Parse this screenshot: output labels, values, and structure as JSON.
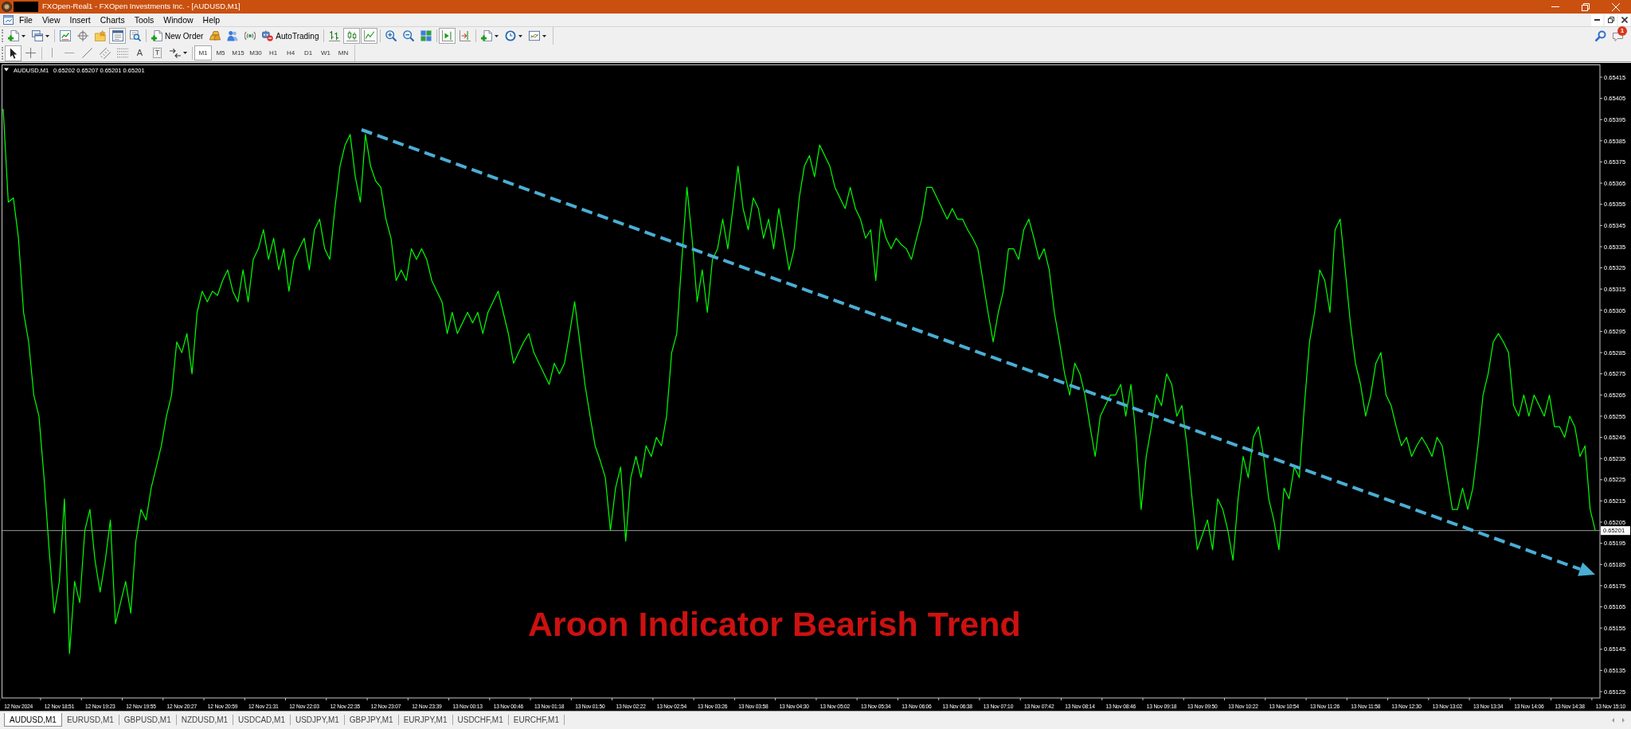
{
  "window": {
    "title": "FXOpen-Real1 - FXOpen Investments Inc. - [AUDUSD,M1]"
  },
  "menu": [
    "File",
    "View",
    "Insert",
    "Charts",
    "Tools",
    "Window",
    "Help"
  ],
  "standard_toolbar": {
    "groups": [
      [
        {
          "kind": "newchart",
          "pressed": false
        },
        {
          "kind": "profiles",
          "pressed": false
        }
      ],
      [
        {
          "kind": "marketwatch",
          "pressed": false
        },
        {
          "kind": "navigator",
          "pressed": false
        },
        {
          "kind": "favorites",
          "pressed": false
        },
        {
          "kind": "datawindow",
          "pressed": true
        },
        {
          "kind": "tester",
          "pressed": false
        }
      ],
      [
        {
          "kind": "neworder",
          "label": "New Order",
          "pressed": false
        },
        {
          "kind": "ingots",
          "pressed": false
        },
        {
          "kind": "editor",
          "pressed": false
        },
        {
          "kind": "signals",
          "pressed": false
        },
        {
          "kind": "autotrading",
          "label": "AutoTrading",
          "pressed": false
        }
      ],
      [
        {
          "kind": "barchart",
          "pressed": false
        },
        {
          "kind": "candles",
          "pressed": true
        },
        {
          "kind": "linechart",
          "pressed": true
        }
      ],
      [
        {
          "kind": "zoomin",
          "pressed": false
        },
        {
          "kind": "zoomout",
          "pressed": false
        },
        {
          "kind": "tile",
          "pressed": false
        }
      ],
      [
        {
          "kind": "autoscroll",
          "pressed": true
        },
        {
          "kind": "chartshift",
          "pressed": false
        }
      ],
      [
        {
          "kind": "indicators",
          "pressed": false
        },
        {
          "kind": "periods",
          "pressed": false
        },
        {
          "kind": "templates",
          "pressed": false
        }
      ]
    ]
  },
  "notifications": {
    "count": "1"
  },
  "line_studies_toolbar": {
    "groups": [
      [
        {
          "kind": "cursor",
          "pressed": true
        },
        {
          "kind": "crosshair",
          "pressed": false
        }
      ],
      [
        {
          "kind": "vline",
          "pressed": false
        },
        {
          "kind": "hline",
          "pressed": false
        },
        {
          "kind": "trendline",
          "pressed": false
        },
        {
          "kind": "channel",
          "pressed": false
        },
        {
          "kind": "fibo",
          "pressed": false
        },
        {
          "kind": "text",
          "glyph": "A",
          "pressed": false
        },
        {
          "kind": "label",
          "glyph": "T",
          "pressed": false
        },
        {
          "kind": "arrows",
          "pressed": false
        }
      ]
    ]
  },
  "timeframes": [
    {
      "label": "M1",
      "selected": true
    },
    {
      "label": "M5",
      "selected": false
    },
    {
      "label": "M15",
      "selected": false
    },
    {
      "label": "M30",
      "selected": false
    },
    {
      "label": "H1",
      "selected": false
    },
    {
      "label": "H4",
      "selected": false
    },
    {
      "label": "D1",
      "selected": false
    },
    {
      "label": "W1",
      "selected": false
    },
    {
      "label": "MN",
      "selected": false
    }
  ],
  "chart": {
    "symbol": "AUDUSD,M1",
    "quote": "0.65202 0.65207 0.65201 0.65201",
    "chart_data": {
      "type": "line",
      "ylim": [
        0.65122,
        0.65421
      ],
      "yticks": [
        0.65415,
        0.65405,
        0.65395,
        0.65385,
        0.65375,
        0.65365,
        0.65355,
        0.65345,
        0.65335,
        0.65325,
        0.65315,
        0.65305,
        0.65295,
        0.65285,
        0.65275,
        0.65265,
        0.65255,
        0.65245,
        0.65235,
        0.65225,
        0.65215,
        0.65205,
        0.65195,
        0.65185,
        0.65175,
        0.65165,
        0.65155,
        0.65145,
        0.65135,
        0.65125
      ],
      "categories": [
        null,
        null,
        null,
        "12 Nov 2024",
        null,
        null,
        null,
        null,
        null,
        null,
        null,
        "12 Nov 18:51",
        null,
        null,
        null,
        null,
        null,
        null,
        null,
        "12 Nov 19:23",
        null,
        null,
        null,
        null,
        null,
        null,
        null,
        "12 Nov 19:55",
        null,
        null,
        null,
        null,
        null,
        null,
        null,
        "12 Nov 20:27",
        null,
        null,
        null,
        null,
        null,
        null,
        null,
        "12 Nov 20:59",
        null,
        null,
        null,
        null,
        null,
        null,
        null,
        "12 Nov 21:31",
        null,
        null,
        null,
        null,
        null,
        null,
        null,
        "12 Nov 22:03",
        null,
        null,
        null,
        null,
        null,
        null,
        null,
        "12 Nov 22:35",
        null,
        null,
        null,
        null,
        null,
        null,
        null,
        "12 Nov 23:07",
        null,
        null,
        null,
        null,
        null,
        null,
        null,
        "12 Nov 23:39",
        null,
        null,
        null,
        null,
        null,
        null,
        null,
        "13 Nov 00:13",
        null,
        null,
        null,
        null,
        null,
        null,
        null,
        "13 Nov 00:46",
        null,
        null,
        null,
        null,
        null,
        null,
        null,
        "13 Nov 01:18",
        null,
        null,
        null,
        null,
        null,
        null,
        null,
        "13 Nov 01:50",
        null,
        null,
        null,
        null,
        null,
        null,
        null,
        "13 Nov 02:22",
        null,
        null,
        null,
        null,
        null,
        null,
        null,
        "13 Nov 02:54",
        null,
        null,
        null,
        null,
        null,
        null,
        null,
        "13 Nov 03:26",
        null,
        null,
        null,
        null,
        null,
        null,
        null,
        "13 Nov 03:58",
        null,
        null,
        null,
        null,
        null,
        null,
        null,
        "13 Nov 04:30",
        null,
        null,
        null,
        null,
        null,
        null,
        null,
        "13 Nov 05:02",
        null,
        null,
        null,
        null,
        null,
        null,
        null,
        "13 Nov 05:34",
        null,
        null,
        null,
        null,
        null,
        null,
        null,
        "13 Nov 06:06",
        null,
        null,
        null,
        null,
        null,
        null,
        null,
        "13 Nov 06:38",
        null,
        null,
        null,
        null,
        null,
        null,
        null,
        "13 Nov 07:10",
        null,
        null,
        null,
        null,
        null,
        null,
        null,
        "13 Nov 07:42",
        null,
        null,
        null,
        null,
        null,
        null,
        null,
        "13 Nov 08:14",
        null,
        null,
        null,
        null,
        null,
        null,
        null,
        "13 Nov 08:46",
        null,
        null,
        null,
        null,
        null,
        null,
        null,
        "13 Nov 09:18",
        null,
        null,
        null,
        null,
        null,
        null,
        null,
        "13 Nov 09:50",
        null,
        null,
        null,
        null,
        null,
        null,
        null,
        "13 Nov 10:22",
        null,
        null,
        null,
        null,
        null,
        null,
        null,
        "13 Nov 10:54",
        null,
        null,
        null,
        null,
        null,
        null,
        null,
        "13 Nov 11:26",
        null,
        null,
        null,
        null,
        null,
        null,
        null,
        "13 Nov 11:58",
        null,
        null,
        null,
        null,
        null,
        null,
        null,
        "13 Nov 12:30",
        null,
        null,
        null,
        null,
        null,
        null,
        null,
        "13 Nov 13:02",
        null,
        null,
        null,
        null,
        null,
        null,
        null,
        "13 Nov 13:34",
        null,
        null,
        null,
        null,
        null,
        null,
        null,
        "13 Nov 14:06",
        null,
        null,
        null,
        null,
        null,
        null,
        null,
        "13 Nov 14:38",
        null,
        null,
        null,
        null,
        null,
        null,
        null,
        "13 Nov 15:10"
      ],
      "series": [
        {
          "color": "#00ff00",
          "values": [
            0.654,
            0.65356,
            0.65358,
            0.65339,
            0.65304,
            0.6529,
            0.65265,
            0.65255,
            0.65226,
            0.65192,
            0.65162,
            0.65177,
            0.65216,
            0.65143,
            0.65177,
            0.65167,
            0.65201,
            0.65211,
            0.65187,
            0.65172,
            0.65187,
            0.65206,
            0.65157,
            0.65167,
            0.65177,
            0.65162,
            0.65196,
            0.65211,
            0.65206,
            0.65221,
            0.65231,
            0.65241,
            0.65255,
            0.65265,
            0.6529,
            0.65285,
            0.65294,
            0.65275,
            0.65304,
            0.65314,
            0.65309,
            0.65314,
            0.65312,
            0.65319,
            0.65324,
            0.65314,
            0.65309,
            0.65324,
            0.65309,
            0.65329,
            0.65334,
            0.65343,
            0.65329,
            0.65339,
            0.65324,
            0.65334,
            0.65314,
            0.65329,
            0.65334,
            0.65339,
            0.65324,
            0.65343,
            0.65348,
            0.65334,
            0.65329,
            0.65353,
            0.65373,
            0.65383,
            0.65388,
            0.65368,
            0.65356,
            0.65388,
            0.65373,
            0.65366,
            0.65363,
            0.65348,
            0.65339,
            0.65319,
            0.65324,
            0.65319,
            0.65334,
            0.65329,
            0.65334,
            0.65329,
            0.65319,
            0.65314,
            0.65309,
            0.65294,
            0.65304,
            0.65294,
            0.65299,
            0.65304,
            0.65299,
            0.65304,
            0.65294,
            0.65304,
            0.65309,
            0.65314,
            0.65304,
            0.65294,
            0.6528,
            0.65285,
            0.6529,
            0.65294,
            0.65285,
            0.6528,
            0.65275,
            0.6527,
            0.6528,
            0.65275,
            0.6528,
            0.65294,
            0.65309,
            0.6529,
            0.6527,
            0.65255,
            0.65241,
            0.65234,
            0.65226,
            0.65201,
            0.65221,
            0.65231,
            0.65196,
            0.65226,
            0.65236,
            0.65226,
            0.65241,
            0.65236,
            0.65245,
            0.65241,
            0.65255,
            0.65285,
            0.65294,
            0.65329,
            0.65363,
            0.65339,
            0.65309,
            0.65324,
            0.65304,
            0.65329,
            0.65334,
            0.65348,
            0.65334,
            0.65353,
            0.65373,
            0.65353,
            0.65343,
            0.65358,
            0.65353,
            0.65339,
            0.65348,
            0.65334,
            0.65353,
            0.65339,
            0.65324,
            0.65334,
            0.65358,
            0.65373,
            0.65378,
            0.65368,
            0.65383,
            0.65378,
            0.65373,
            0.65363,
            0.65358,
            0.65353,
            0.65363,
            0.65353,
            0.65348,
            0.65339,
            0.65343,
            0.65319,
            0.65348,
            0.65339,
            0.65334,
            0.65339,
            0.65336,
            0.65334,
            0.65329,
            0.65339,
            0.65348,
            0.65363,
            0.65363,
            0.65358,
            0.65353,
            0.65348,
            0.65353,
            0.65348,
            0.65348,
            0.65343,
            0.65339,
            0.65334,
            0.65319,
            0.65304,
            0.6529,
            0.65304,
            0.65314,
            0.65334,
            0.65334,
            0.65329,
            0.65343,
            0.65348,
            0.65339,
            0.65329,
            0.65334,
            0.65324,
            0.65304,
            0.6529,
            0.65275,
            0.65265,
            0.6528,
            0.65275,
            0.65265,
            0.6525,
            0.65236,
            0.65255,
            0.6526,
            0.65265,
            0.65265,
            0.6527,
            0.65255,
            0.6527,
            0.65245,
            0.65211,
            0.65236,
            0.6525,
            0.65265,
            0.6526,
            0.65275,
            0.6527,
            0.65255,
            0.6526,
            0.65241,
            0.65216,
            0.65192,
            0.65199,
            0.65206,
            0.65192,
            0.65216,
            0.65211,
            0.65201,
            0.65187,
            0.65216,
            0.65236,
            0.65226,
            0.65245,
            0.6525,
            0.65236,
            0.65216,
            0.65206,
            0.65192,
            0.65221,
            0.65216,
            0.65231,
            0.65226,
            0.6526,
            0.6529,
            0.65304,
            0.65324,
            0.65319,
            0.65304,
            0.65343,
            0.65348,
            0.65324,
            0.65299,
            0.6528,
            0.6527,
            0.65255,
            0.65265,
            0.6528,
            0.65285,
            0.65265,
            0.6526,
            0.6525,
            0.65241,
            0.65245,
            0.65236,
            0.65241,
            0.65245,
            0.65241,
            0.65236,
            0.65245,
            0.65241,
            0.65226,
            0.65211,
            0.65211,
            0.65221,
            0.65211,
            0.65221,
            0.65241,
            0.65265,
            0.65275,
            0.6529,
            0.65294,
            0.6529,
            0.65285,
            0.6526,
            0.65255,
            0.65265,
            0.65255,
            0.65265,
            0.6526,
            0.65255,
            0.65265,
            0.6525,
            0.6525,
            0.65245,
            0.65255,
            0.6525,
            0.65236,
            0.65241,
            0.65211,
            0.65201,
            null,
            null,
            null
          ]
        }
      ],
      "ref_lines": [
        {
          "axis": "y",
          "value": 0.65201,
          "label": "0.65201"
        }
      ],
      "annotations": [
        {
          "text": "Aroon Indicator Bearish Trend"
        }
      ]
    }
  },
  "chart_tabs": [
    {
      "label": "AUDUSD,M1",
      "selected": true
    },
    {
      "label": "EURUSD,M1",
      "selected": false
    },
    {
      "label": "GBPUSD,M1",
      "selected": false
    },
    {
      "label": "NZDUSD,M1",
      "selected": false
    },
    {
      "label": "USDCAD,M1",
      "selected": false
    },
    {
      "label": "USDJPY,M1",
      "selected": false
    },
    {
      "label": "GBPJPY,M1",
      "selected": false
    },
    {
      "label": "EURJPY,M1",
      "selected": false
    },
    {
      "label": "USDCHF,M1",
      "selected": false
    },
    {
      "label": "EURCHF,M1",
      "selected": false
    }
  ]
}
